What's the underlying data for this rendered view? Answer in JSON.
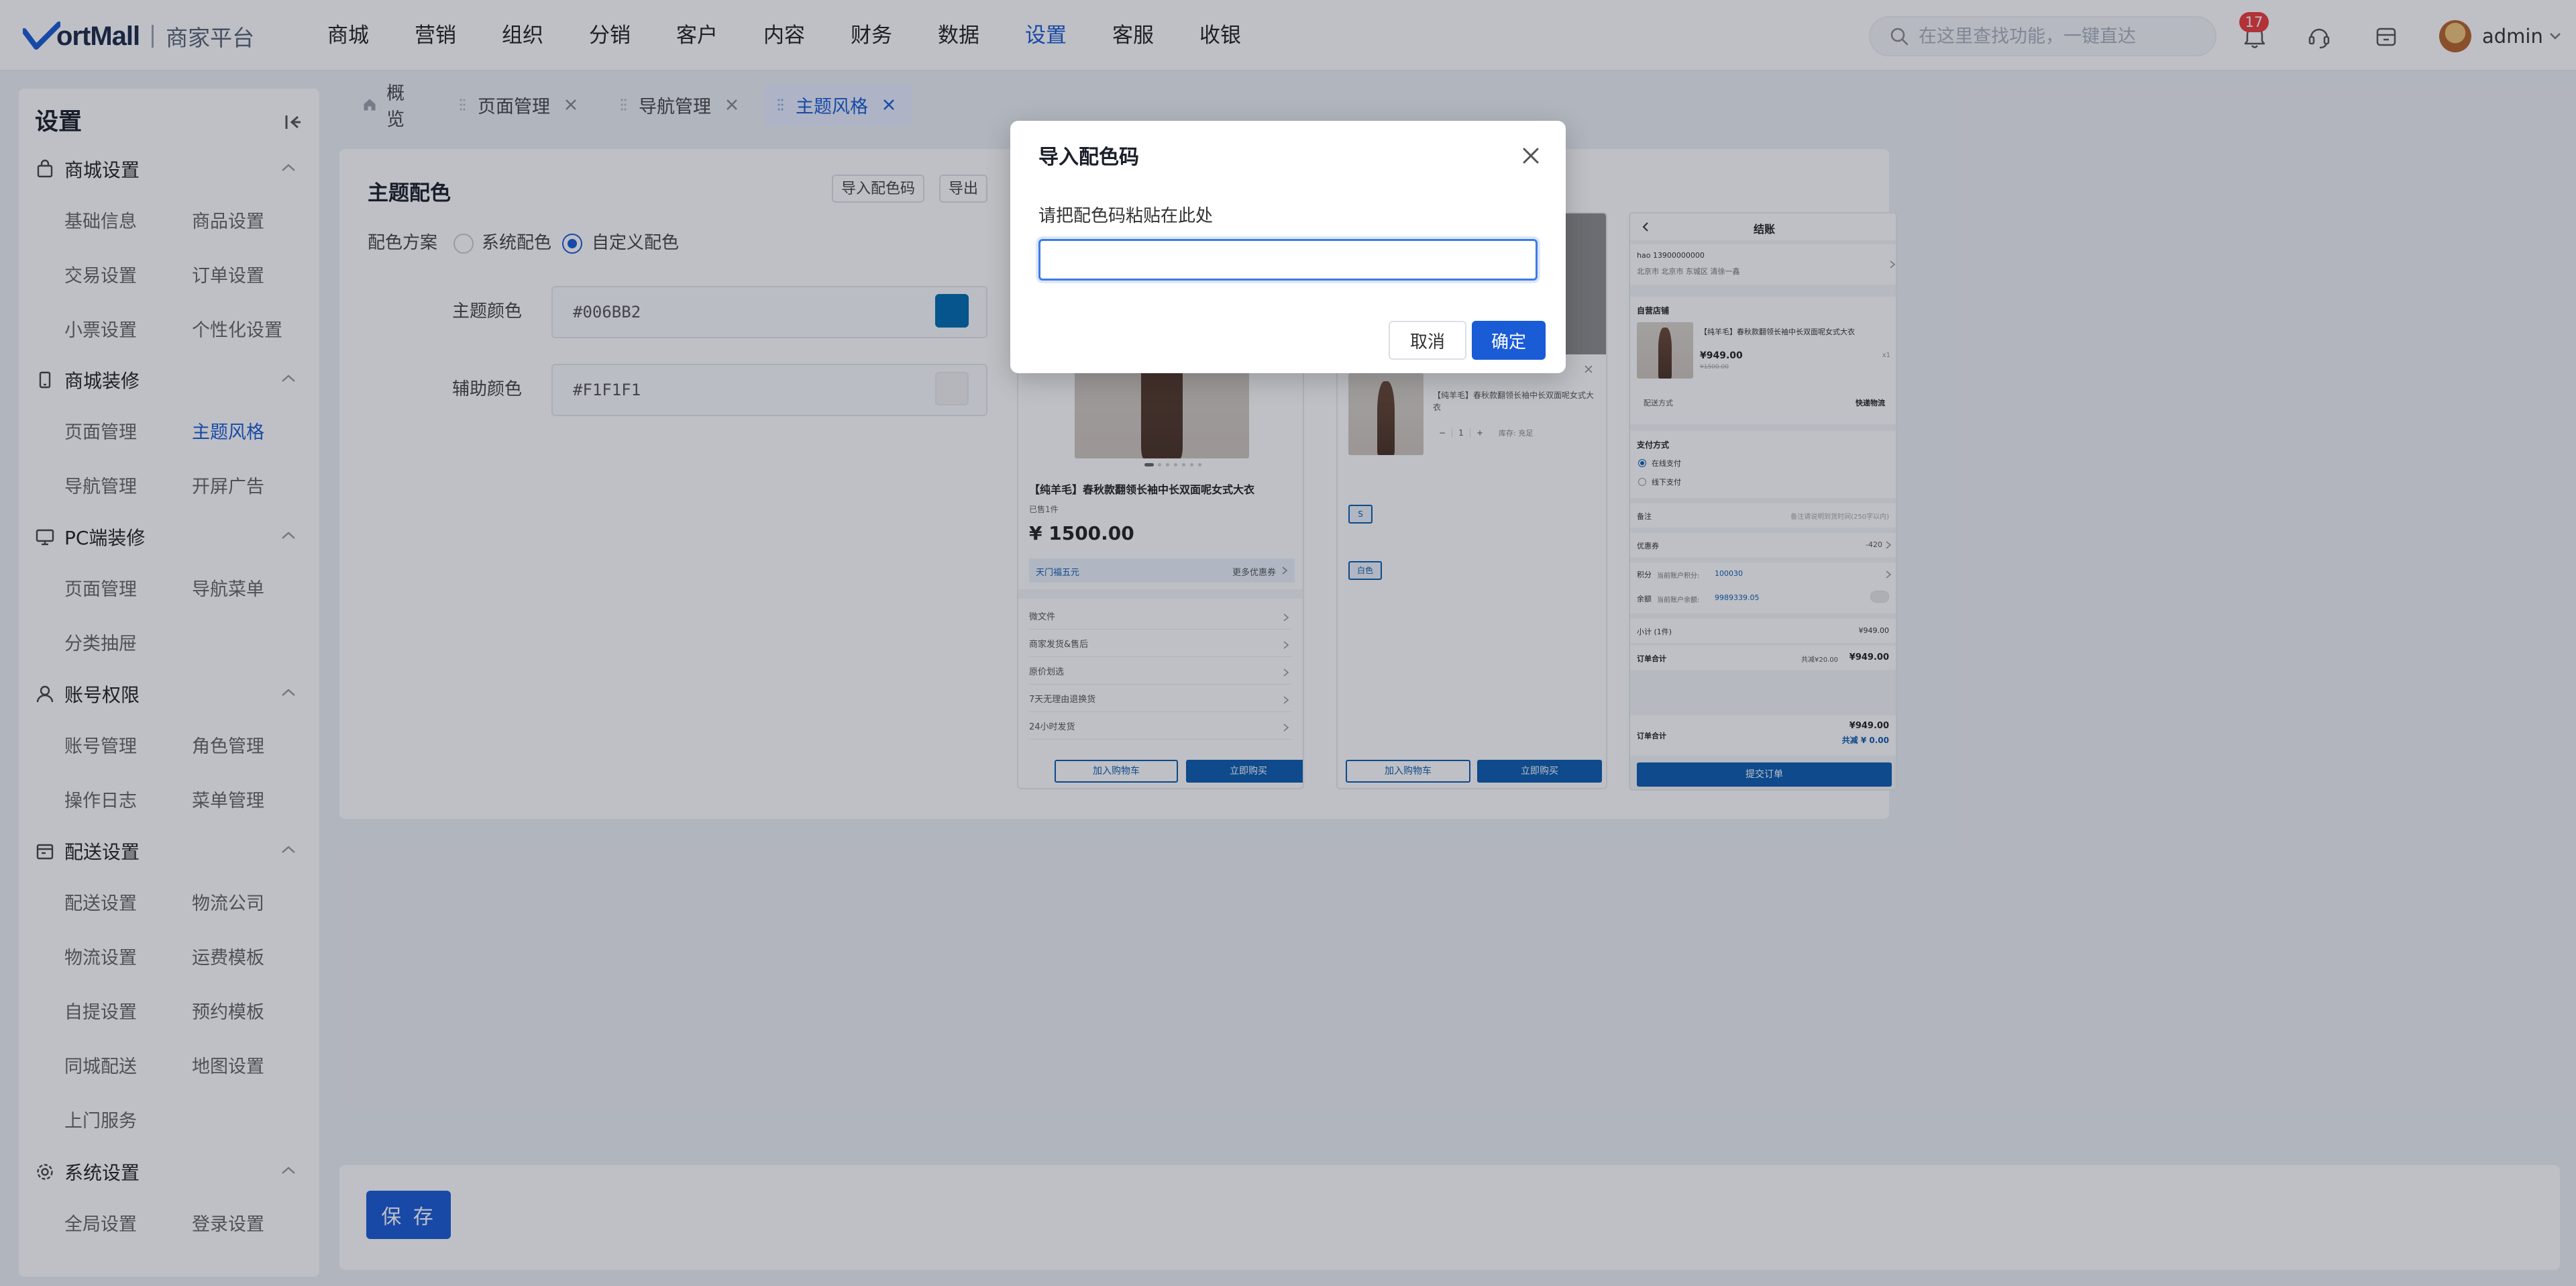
{
  "brand": {
    "logo_text": "ortMall",
    "subtitle": "商家平台"
  },
  "topnav": [
    "商城",
    "营销",
    "组织",
    "分销",
    "客户",
    "内容",
    "财务",
    "数据",
    "设置",
    "客服",
    "收银"
  ],
  "search": {
    "placeholder": "在这里查找功能，一键直达"
  },
  "header": {
    "notification_count": "17",
    "user": "admin"
  },
  "sidebar": {
    "title": "设置",
    "groups": [
      {
        "label": "商城设置",
        "items": [
          "基础信息",
          "商品设置",
          "交易设置",
          "订单设置",
          "小票设置",
          "个性化设置"
        ]
      },
      {
        "label": "商城装修",
        "items": [
          "页面管理",
          "主题风格",
          "导航管理",
          "开屏广告"
        ]
      },
      {
        "label": "PC端装修",
        "items": [
          "页面管理",
          "导航菜单",
          "分类抽屉"
        ]
      },
      {
        "label": "账号权限",
        "items": [
          "账号管理",
          "角色管理",
          "操作日志",
          "菜单管理"
        ]
      },
      {
        "label": "配送设置",
        "items": [
          "配送设置",
          "物流公司",
          "物流设置",
          "运费模板",
          "自提设置",
          "预约模板",
          "同城配送",
          "地图设置",
          "上门服务"
        ]
      },
      {
        "label": "系统设置",
        "items": [
          "全局设置",
          "登录设置"
        ]
      }
    ]
  },
  "tabs": [
    "概览",
    "页面管理",
    "导航管理",
    "主题风格"
  ],
  "theme": {
    "title": "主题配色",
    "import_btn": "导入配色码",
    "export_btn": "导出",
    "scheme_label": "配色方案",
    "option_system": "系统配色",
    "option_custom": "自定义配色",
    "primary_label": "主题颜色",
    "primary_value": "#006BB2",
    "secondary_label": "辅助颜色",
    "secondary_value": "#F1F1F1"
  },
  "colors": {
    "accent": "#1a5bd6",
    "primary": "#006BB2",
    "secondary": "#F1F1F1",
    "badge": "#ee3b3b"
  },
  "preview1": {
    "product_title": "【纯羊毛】春秋款翻领长袖中长双面呢女式大衣",
    "sold": "已售1件",
    "price": "¥ 1500.00",
    "promo": "天门福五元",
    "more_coupons": "更多优惠券",
    "rows": [
      "微文件",
      "商家发货&售后",
      "原价划选",
      "7天无理由退换货",
      "24小时发货"
    ],
    "add_cart": "加入购物车",
    "buy_now": "立即购买"
  },
  "preview2": {
    "product_title": "【纯羊毛】春秋款翻领长袖中长双面呢女式大衣",
    "qty": "1",
    "stock": "库存: 充足",
    "size_tag": "S",
    "color_tag": "白色",
    "add_cart": "加入购物车",
    "buy_now": "立即购买"
  },
  "preview3": {
    "title": "结账",
    "name_phone": "hao  13900000000",
    "address": "北京市 北京市 东城区 清徐一鑫",
    "store": "自营店铺",
    "product_title": "【纯羊毛】春秋款翻领长袖中长双面呢女式大衣",
    "price": "¥949.00",
    "orig_price": "¥1500.00",
    "qty": "x1",
    "delivery_label": "配送方式",
    "delivery_value": "快递物流",
    "pay_label": "支付方式",
    "pay_online": "在线支付",
    "pay_offline": "线下支付",
    "remark_label": "备注",
    "remark_placeholder": "备注请说明到货时间(250字以内)",
    "coupon_label": "优惠券",
    "coupon_value": "-420",
    "points_label": "积分",
    "points_text": "当前账户积分:",
    "points_value": "100030",
    "balance_label": "余额",
    "balance_text": "当前账户余额:",
    "balance_value": "9989339.05",
    "subtotal_label": "小计 (1件)",
    "subtotal_value": "¥949.00",
    "order_total_label": "订单合计",
    "order_total_discount": "共减¥20.00",
    "order_total_value": "¥949.00",
    "footer_label": "订单合计",
    "footer_value": "¥949.00",
    "footer_discount": "共减 ¥ 0.00",
    "submit": "提交订单"
  },
  "save": {
    "label": "保 存"
  },
  "modal": {
    "title": "导入配色码",
    "label": "请把配色码粘贴在此处",
    "input_value": "",
    "cancel": "取消",
    "ok": "确定"
  }
}
